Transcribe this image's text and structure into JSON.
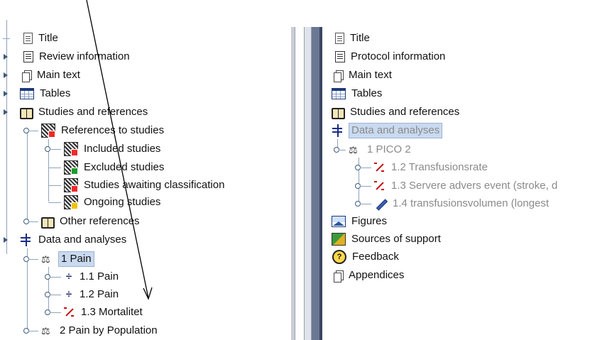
{
  "left_tree": {
    "title": "Title",
    "review_information": "Review information",
    "main_text": "Main text",
    "tables": "Tables",
    "studies_and_references": "Studies and references",
    "references_to_studies": "References to studies",
    "included_studies": "Included studies",
    "excluded_studies": "Excluded studies",
    "awaiting_classification": "Studies awaiting classification",
    "ongoing_studies": "Ongoing studies",
    "other_references": "Other references",
    "data_and_analyses": "Data and analyses",
    "pain_1": "1 Pain",
    "pain_1_1": "1.1 Pain",
    "pain_1_2": "1.2 Pain",
    "mortalitet_1_3": "1.3 Mortalitet",
    "pain_by_population": "2 Pain by Population"
  },
  "right_tree": {
    "title": "Title",
    "protocol_information": "Protocol information",
    "main_text": "Main text",
    "tables": "Tables",
    "studies_and_references": "Studies and references",
    "data_and_analyses": "Data and analyses",
    "pico_2": "1 PICO 2",
    "transfusionsrate": "1.2 Transfusionsrate",
    "servere_advers": "1.3 Servere advers event (stroke, d",
    "transfusionsvolumen": "1.4 transfusionsvolumen (longest",
    "figures": "Figures",
    "sources_of_support": "Sources of support",
    "feedback": "Feedback",
    "appendices": "Appendices"
  },
  "icons": {
    "feedback_glyph": "?",
    "scale_glyph": "⚖",
    "fraction_glyph": "÷"
  },
  "colors": {
    "selection": "#c9daf0",
    "divider_dark": "#3b4663"
  }
}
